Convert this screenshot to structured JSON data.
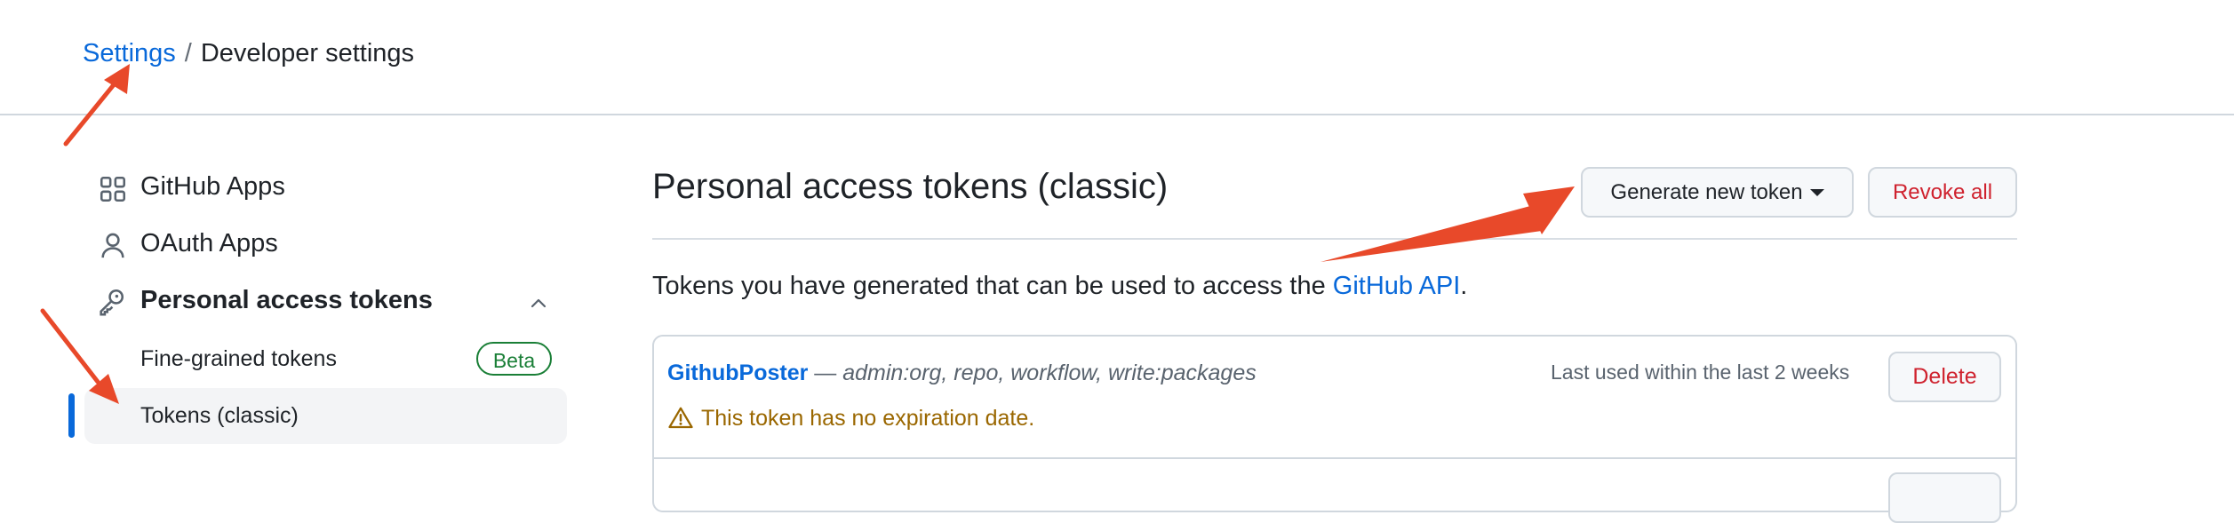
{
  "breadcrumb": {
    "parent": "Settings",
    "separator": "/",
    "current": "Developer settings"
  },
  "sidebar": {
    "items": [
      {
        "label": "GitHub Apps",
        "icon": "apps-grid-icon"
      },
      {
        "label": "OAuth Apps",
        "icon": "person-icon"
      },
      {
        "label": "Personal access tokens",
        "icon": "key-icon",
        "expanded": true
      }
    ],
    "subitems": [
      {
        "label": "Fine-grained tokens",
        "badge": "Beta"
      },
      {
        "label": "Tokens (classic)",
        "active": true
      }
    ]
  },
  "main": {
    "title": "Personal access tokens (classic)",
    "generate_button": "Generate new token",
    "revoke_button": "Revoke all",
    "description_prefix": "Tokens you have generated that can be used to access the ",
    "description_link": "GitHub API",
    "description_suffix": ".",
    "tokens": [
      {
        "name": "GithubPoster",
        "dash": " — ",
        "scopes": "admin:org, repo, workflow, write:packages",
        "last_used": "Last used within the last 2 weeks",
        "delete_label": "Delete",
        "warning": "This token has no expiration date."
      }
    ]
  },
  "colors": {
    "link": "#0969da",
    "danger": "#cf222e",
    "success": "#1a7f37",
    "warning": "#9a6700",
    "annotation_arrow": "#e8492a"
  }
}
